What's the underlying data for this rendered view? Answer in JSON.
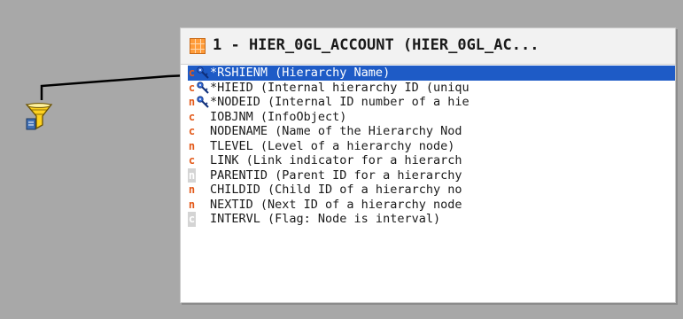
{
  "table": {
    "title": "1 - HIER_0GL_ACCOUNT (HIER_0GL_AC..."
  },
  "fields": [
    {
      "type": "c",
      "key": true,
      "label": "*RSHIENM (Hierarchy Name)",
      "selected": true
    },
    {
      "type": "c",
      "key": true,
      "label": "*HIEID (Internal hierarchy ID (uniqu",
      "selected": false
    },
    {
      "type": "n",
      "key": true,
      "label": "*NODEID (Internal ID number of a hie",
      "selected": false
    },
    {
      "type": "c",
      "key": false,
      "label": "IOBJNM (InfoObject)",
      "selected": false
    },
    {
      "type": "c",
      "key": false,
      "label": "NODENAME (Name of the Hierarchy Nod",
      "selected": false
    },
    {
      "type": "n",
      "key": false,
      "label": "TLEVEL (Level of a hierarchy node)",
      "selected": false
    },
    {
      "type": "c",
      "key": false,
      "label": "LINK (Link indicator for a hierarch",
      "selected": false
    },
    {
      "type": "n",
      "key": false,
      "label": "PARENTID (Parent ID for a hierarchy",
      "selected": false,
      "faded": true
    },
    {
      "type": "n",
      "key": false,
      "label": "CHILDID (Child ID of a hierarchy no",
      "selected": false
    },
    {
      "type": "n",
      "key": false,
      "label": "NEXTID (Next ID of a hierarchy node",
      "selected": false
    },
    {
      "type": "c",
      "key": false,
      "label": "INTERVL (Flag: Node is interval)",
      "selected": false,
      "faded": true
    }
  ],
  "icons": {
    "filter": "filter-funnel-icon",
    "table": "table-grid-icon",
    "key": "key-icon"
  },
  "colors": {
    "background": "#a8a8a8",
    "selection": "#1e5bc6",
    "type_badge": "#e35a1a",
    "table_icon": "#ff9c3a"
  }
}
